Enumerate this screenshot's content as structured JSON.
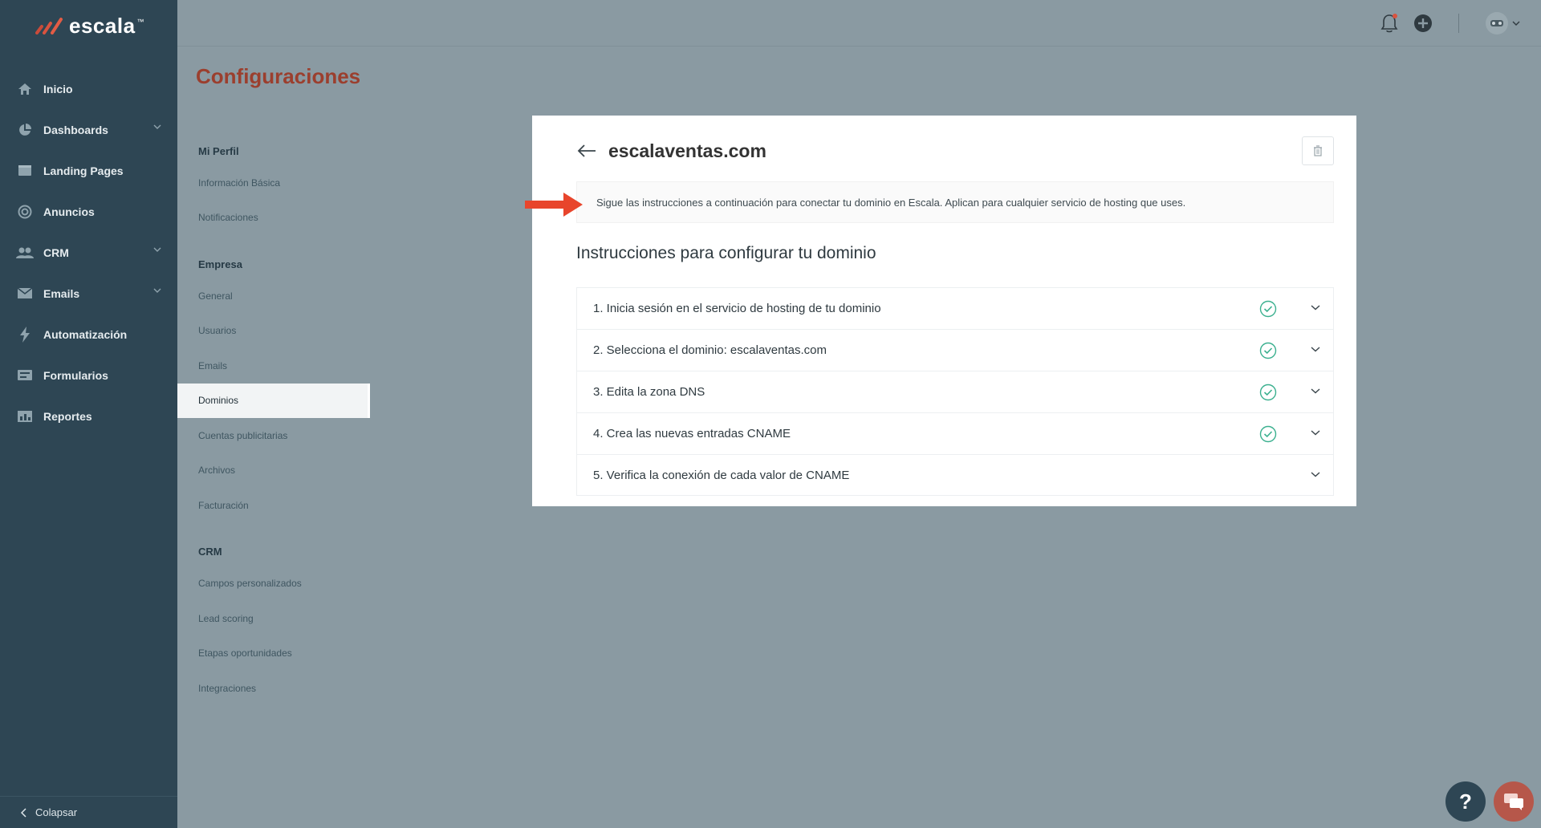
{
  "app": {
    "logo_text": "escala",
    "logo_tm": "™"
  },
  "sidebar": {
    "items": [
      {
        "label": "Inicio",
        "icon": "home-icon",
        "has_children": false
      },
      {
        "label": "Dashboards",
        "icon": "pie-chart-icon",
        "has_children": true
      },
      {
        "label": "Landing Pages",
        "icon": "folder-icon",
        "has_children": false
      },
      {
        "label": "Anuncios",
        "icon": "target-icon",
        "has_children": false
      },
      {
        "label": "CRM",
        "icon": "users-icon",
        "has_children": true
      },
      {
        "label": "Emails",
        "icon": "mail-icon",
        "has_children": true
      },
      {
        "label": "Automatización",
        "icon": "bolt-icon",
        "has_children": false
      },
      {
        "label": "Formularios",
        "icon": "form-icon",
        "has_children": false
      },
      {
        "label": "Reportes",
        "icon": "report-icon",
        "has_children": false
      }
    ],
    "collapse_label": "Colapsar"
  },
  "page": {
    "title": "Configuraciones"
  },
  "settings_menu": {
    "groups": [
      {
        "label": "Mi Perfil",
        "items": [
          "Información Básica",
          "Notificaciones"
        ]
      },
      {
        "label": "Empresa",
        "items": [
          "General",
          "Usuarios",
          "Emails",
          "Dominios",
          "Cuentas publicitarias",
          "Archivos",
          "Facturación"
        ]
      },
      {
        "label": "CRM",
        "items": [
          "Campos personalizados",
          "Lead scoring",
          "Etapas oportunidades",
          "Integraciones"
        ]
      }
    ],
    "active_item": "Dominios"
  },
  "domain_card": {
    "domain": "escalaventas.com",
    "notice": "Sigue las instrucciones a continuación para conectar tu dominio en Escala. Aplican para cualquier servicio de hosting que uses.",
    "subtitle": "Instrucciones para configurar tu dominio",
    "steps": [
      {
        "label": "1. Inicia sesión en el servicio de hosting de tu dominio",
        "done": true
      },
      {
        "label": "2. Selecciona el dominio: escalaventas.com",
        "done": true
      },
      {
        "label": "3. Edita la zona DNS",
        "done": true
      },
      {
        "label": "4. Crea las nuevas entradas CNAME",
        "done": true
      },
      {
        "label": "5. Verifica la conexión de cada valor de CNAME",
        "done": false
      }
    ]
  },
  "fab": {
    "help_label": "?"
  },
  "colors": {
    "sidebar_bg": "#2e4654",
    "title": "#9b3f2e",
    "accent_check": "#3bb08f",
    "arrow": "#e8452c"
  }
}
